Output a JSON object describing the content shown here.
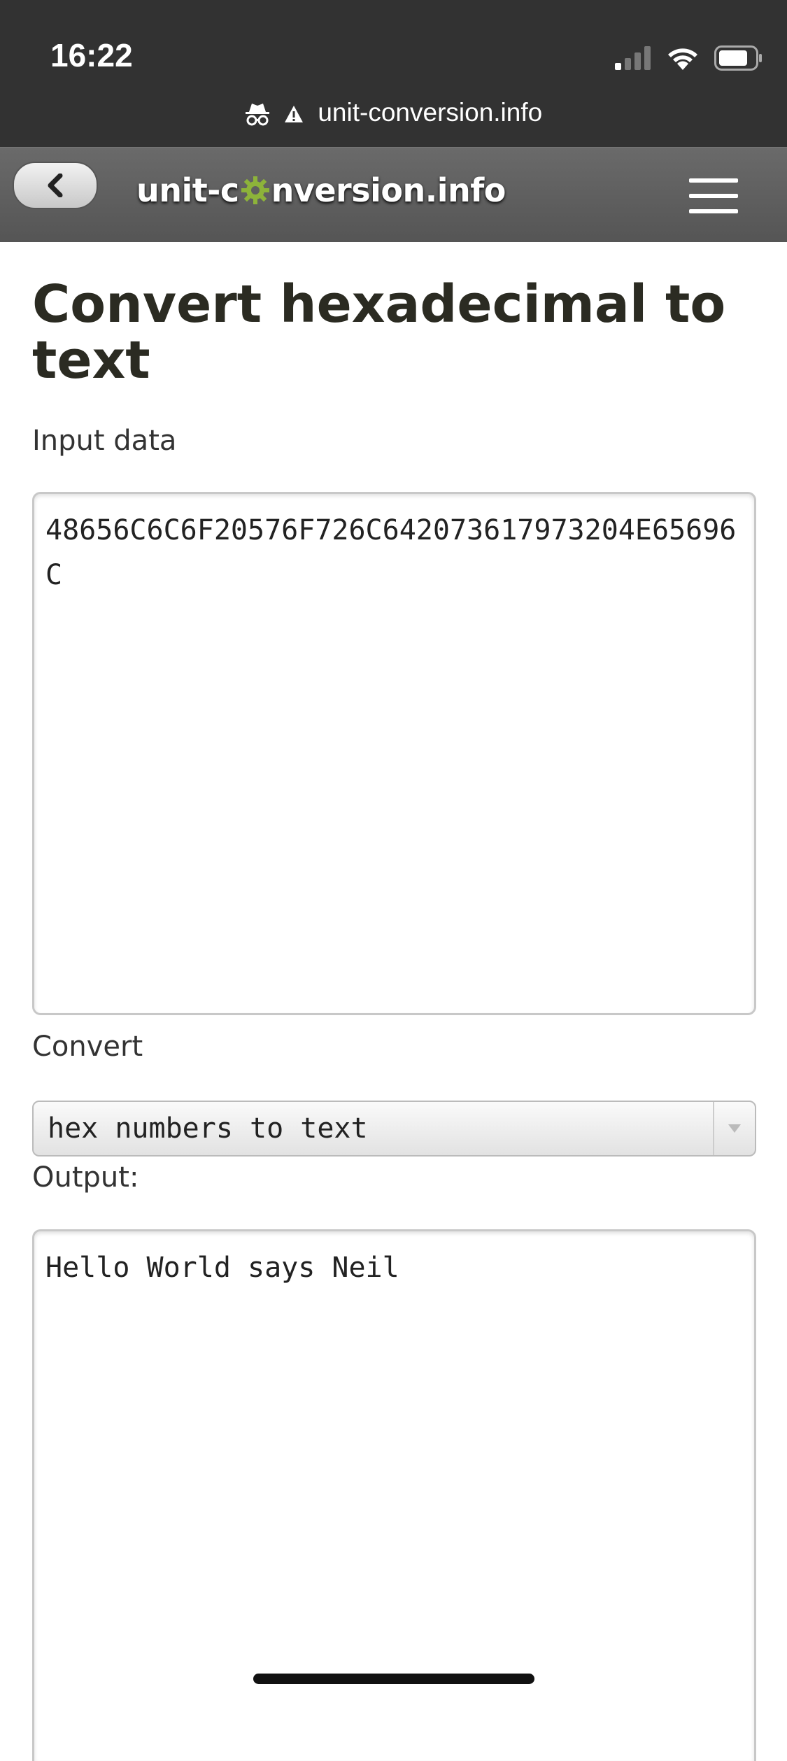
{
  "status_bar": {
    "time": "16:22",
    "icons": [
      "signal-icon",
      "wifi-icon",
      "battery-icon"
    ]
  },
  "browser": {
    "url": "unit-conversion.info",
    "icons": [
      "incognito-icon",
      "warning-icon"
    ]
  },
  "header": {
    "logo_prefix": "unit-c",
    "logo_suffix": "nversion.info",
    "back_icon": "chevron-left-icon",
    "menu_icon": "hamburger-menu-icon",
    "logo_gear_color": "#8db33a"
  },
  "main": {
    "title": "Convert hexadecimal to text",
    "input_label": "Input data",
    "input_value": "48656C6C6F20576F726C642073617973204E65696C",
    "convert_label": "Convert",
    "convert_selected": "hex numbers to text",
    "output_label": "Output:",
    "output_value": "Hello World says Neil"
  }
}
